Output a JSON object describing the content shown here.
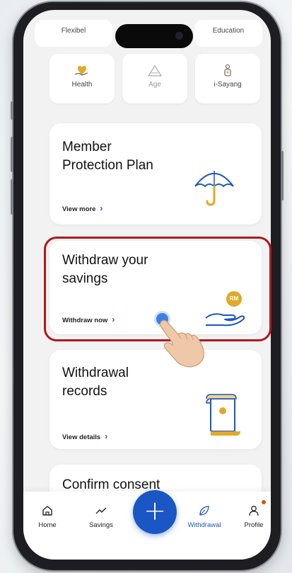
{
  "top_tabs": [
    "Flexibel",
    "Education"
  ],
  "categories": [
    {
      "label": "Health",
      "icon": "heart-hand-icon",
      "dim": false
    },
    {
      "label": "Age",
      "icon": "age-triangle-icon",
      "dim": true
    },
    {
      "label": "i-Sayang",
      "icon": "family-icon",
      "dim": false
    }
  ],
  "cards": {
    "member_protection": {
      "title_line1": "Member",
      "title_line2": "Protection Plan",
      "link": "View more",
      "icon": "umbrella-icon"
    },
    "withdraw_savings": {
      "title_line1": "Withdraw your",
      "title_line2": "savings",
      "link": "Withdraw now",
      "icon": "rm-coin-hand-icon",
      "coin_text": "RM"
    },
    "withdrawal_records": {
      "title_line1": "Withdrawal",
      "title_line2": "records",
      "link": "View details",
      "icon": "scroll-document-icon"
    },
    "confirm_consent": {
      "title_line1": "Confirm consent"
    }
  },
  "tabbar": {
    "home": "Home",
    "savings": "Savings",
    "add": "+",
    "withdrawal": "Withdrawal",
    "profile": "Profile"
  },
  "colors": {
    "accent": "#1a56c4",
    "highlight": "#b0181c",
    "gold": "#e0a92a"
  }
}
